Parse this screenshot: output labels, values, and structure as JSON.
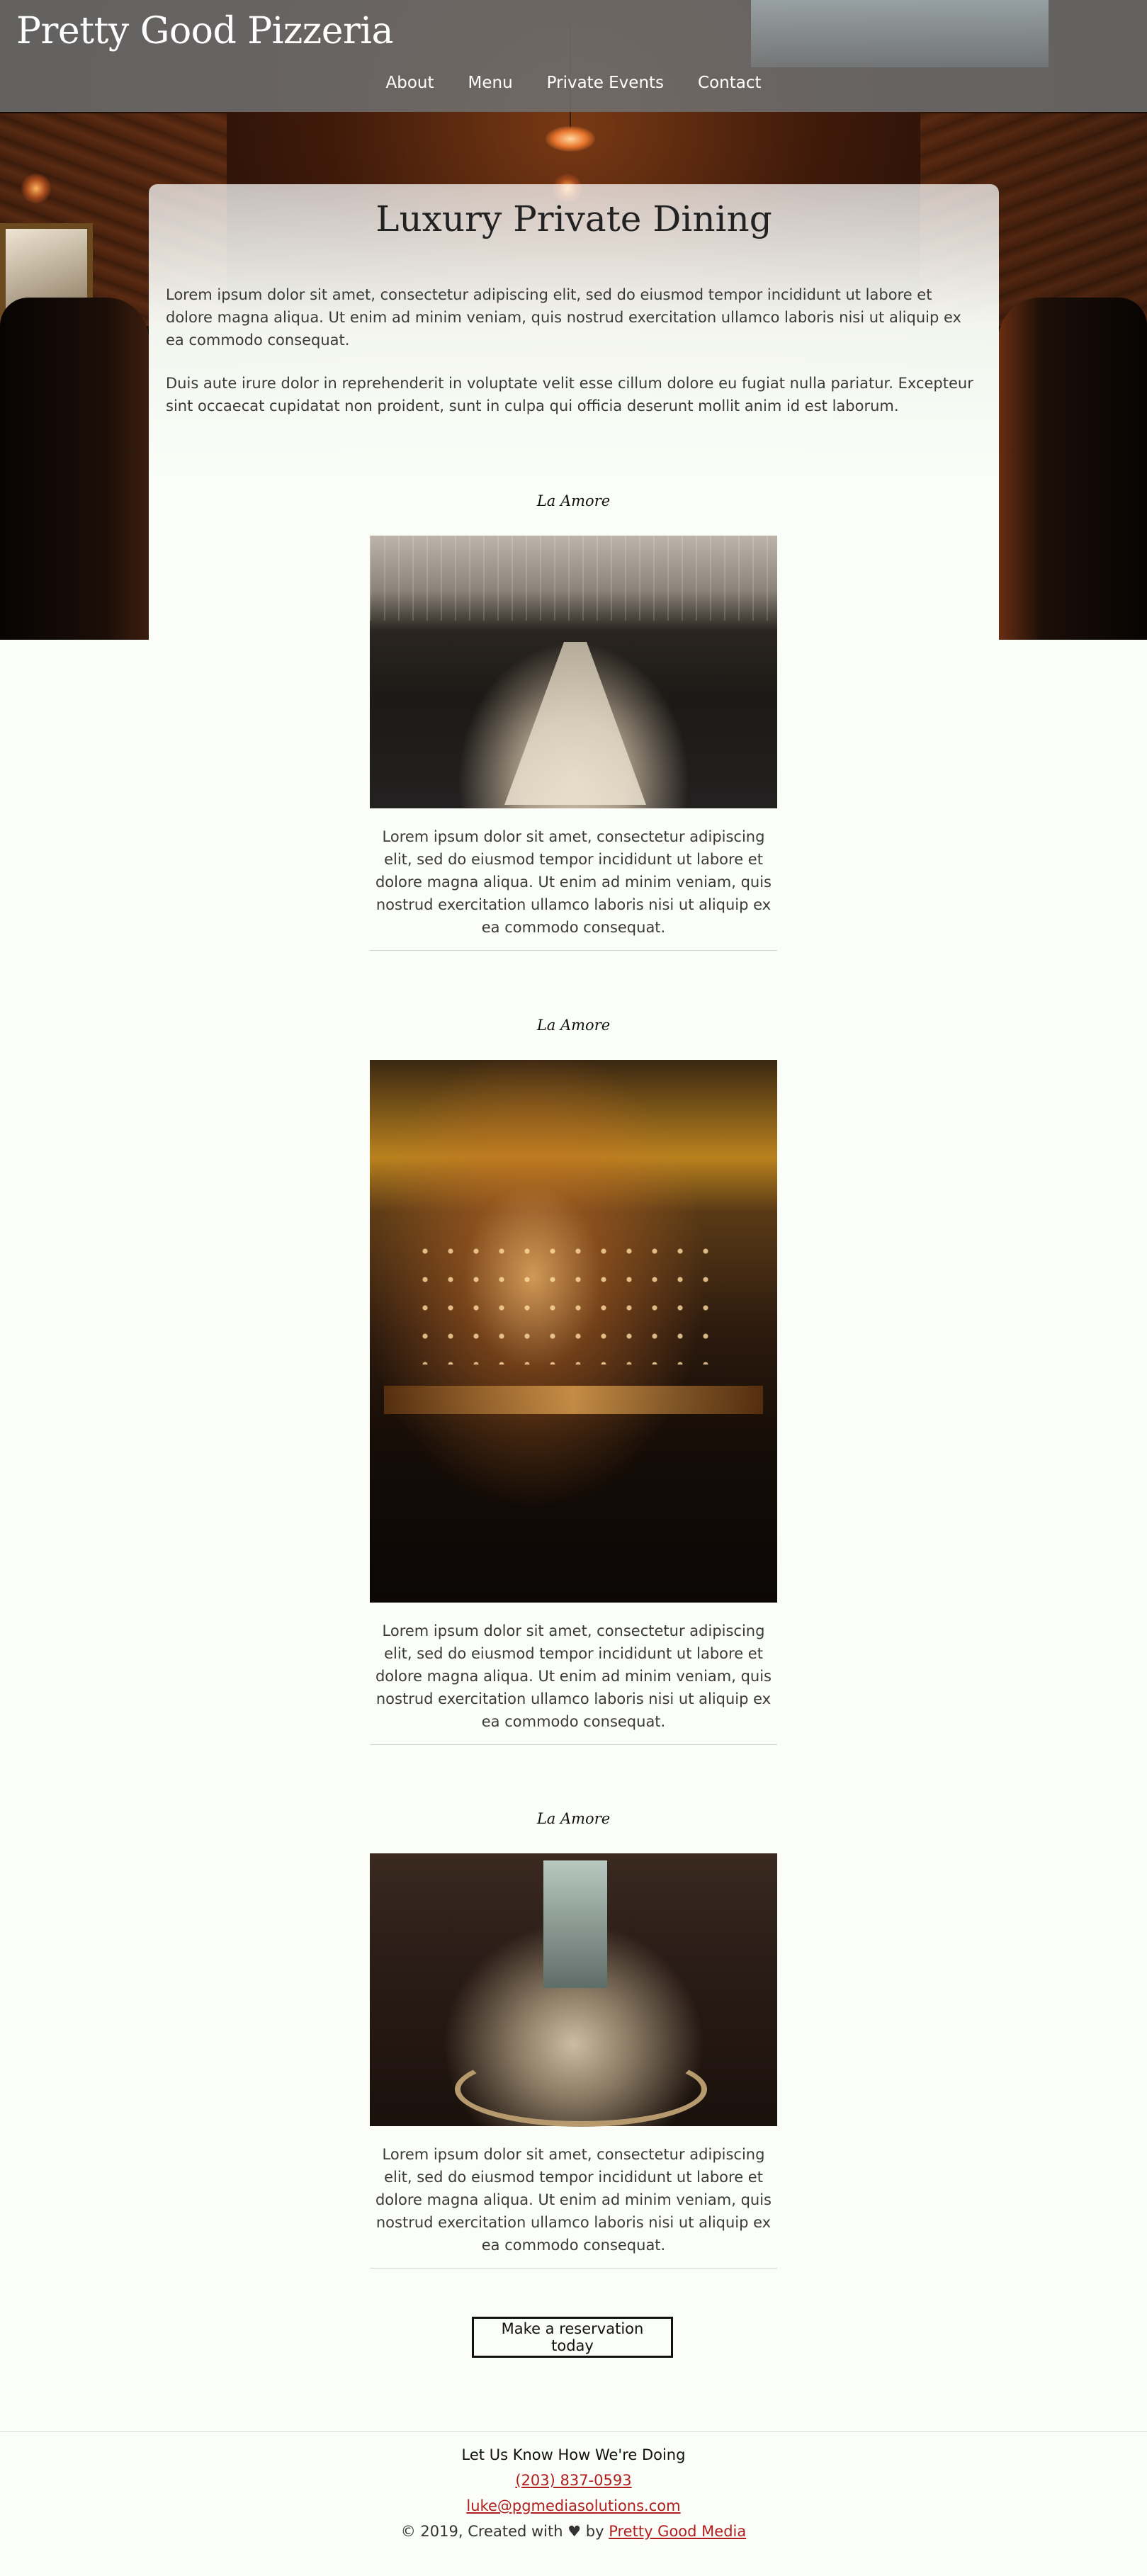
{
  "header": {
    "brand": "Pretty Good Pizzeria",
    "nav": [
      "About",
      "Menu",
      "Private Events",
      "Contact"
    ]
  },
  "main": {
    "title": "Luxury Private Dining",
    "intro_paragraphs": [
      "Lorem ipsum dolor sit amet, consectetur adipiscing elit, sed do eiusmod tempor incididunt ut labore et dolore magna aliqua. Ut enim ad minim veniam, quis nostrud exercitation ullamco laboris nisi ut aliquip ex ea commodo consequat.",
      "Duis aute irure dolor in reprehenderit in voluptate velit esse cillum dolore eu fugiat nulla pariatur. Excepteur sint occaecat cupidatat non proident, sunt in culpa qui officia deserunt mollit anim id est laborum."
    ],
    "venues": [
      {
        "name": "La Amore",
        "description": "Lorem ipsum dolor sit amet, consectetur adipiscing elit, sed do eiusmod tempor incididunt ut labore et dolore magna aliqua. Ut enim ad minim veniam, quis nostrud exercitation ullamco laboris nisi ut aliquip ex ea commodo consequat."
      },
      {
        "name": "La Amore",
        "description": "Lorem ipsum dolor sit amet, consectetur adipiscing elit, sed do eiusmod tempor incididunt ut labore et dolore magna aliqua. Ut enim ad minim veniam, quis nostrud exercitation ullamco laboris nisi ut aliquip ex ea commodo consequat."
      },
      {
        "name": "La Amore",
        "description": "Lorem ipsum dolor sit amet, consectetur adipiscing elit, sed do eiusmod tempor incididunt ut labore et dolore magna aliqua. Ut enim ad minim veniam, quis nostrud exercitation ullamco laboris nisi ut aliquip ex ea commodo consequat."
      }
    ],
    "cta_label": "Make a reservation today"
  },
  "footer": {
    "heading": "Let Us Know How We're Doing",
    "phone": "(203) 837-0593",
    "email": "luke@pgmediasolutions.com",
    "credit_prefix": "© 2019, Created with",
    "heart_icon": "♥",
    "credit_by": "by",
    "credit_link": "Pretty Good Media"
  },
  "colors": {
    "page_background": "#fbfef8",
    "header_overlay": "#6e6e6e",
    "link_red": "#b01e1e",
    "text_dark": "#333333"
  }
}
